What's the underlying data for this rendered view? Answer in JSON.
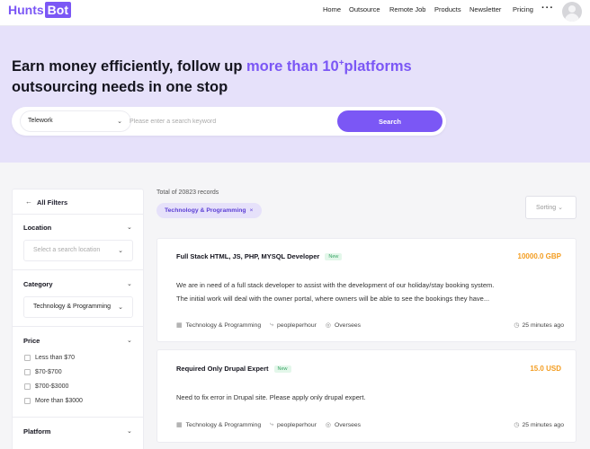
{
  "header": {
    "logo_part1": "Hunts",
    "logo_part2": "Bot",
    "nav": [
      "Home",
      "Outsource",
      "Remote Job",
      "Products",
      "Newsletter",
      "Pricing"
    ],
    "more_icon": "ellipsis-icon",
    "avatar_icon": "user-avatar-icon"
  },
  "hero": {
    "title_part1": "Earn money efficiently, follow up ",
    "title_accent": "more than 10",
    "title_sup": "+",
    "title_part2": "platforms",
    "title_line2": "outsourcing needs in one stop",
    "search_type": "Telework",
    "search_placeholder": "Please enter a search keyword",
    "search_button": "Search"
  },
  "filters": {
    "all_filters": "All Filters",
    "location_title": "Location",
    "location_placeholder": "Select a search location",
    "category_title": "Category",
    "category_value": "Technology & Programming",
    "price_title": "Price",
    "price_options": [
      "Less than $70",
      "$70-$700",
      "$700-$3000",
      "More than $3000"
    ],
    "platform_title": "Platform"
  },
  "results": {
    "total": "Total of 20823 records",
    "active_chip": "Technology & Programming",
    "chip_close": "×",
    "sorting": "Sorting"
  },
  "jobs": [
    {
      "title": "Full Stack HTML, JS, PHP, MYSQL Developer",
      "badge": "New",
      "price": "10000.0 GBP",
      "desc_line1": "We are in need of a full stack developer to assist with the development of our holiday/stay booking system.",
      "desc_line2": "The initial work will deal with the owner portal, where owners will be able to see the bookings they have...",
      "category": "Technology & Programming",
      "platform": "peopleperhour",
      "location": "Oversees",
      "time": "25 minutes ago"
    },
    {
      "title": "Required Only Drupal Expert",
      "badge": "New",
      "price": "15.0 USD",
      "desc_line1": "Need to fix error in Drupal site. Please apply only drupal expert.",
      "category": "Technology & Programming",
      "platform": "peopleperhour",
      "location": "Oversees",
      "time": "25 minutes ago"
    }
  ],
  "colors": {
    "accent": "#7b57f5",
    "hero_bg": "#e6e1fa",
    "price": "#f39c1f",
    "new_badge": "#3aa566"
  }
}
